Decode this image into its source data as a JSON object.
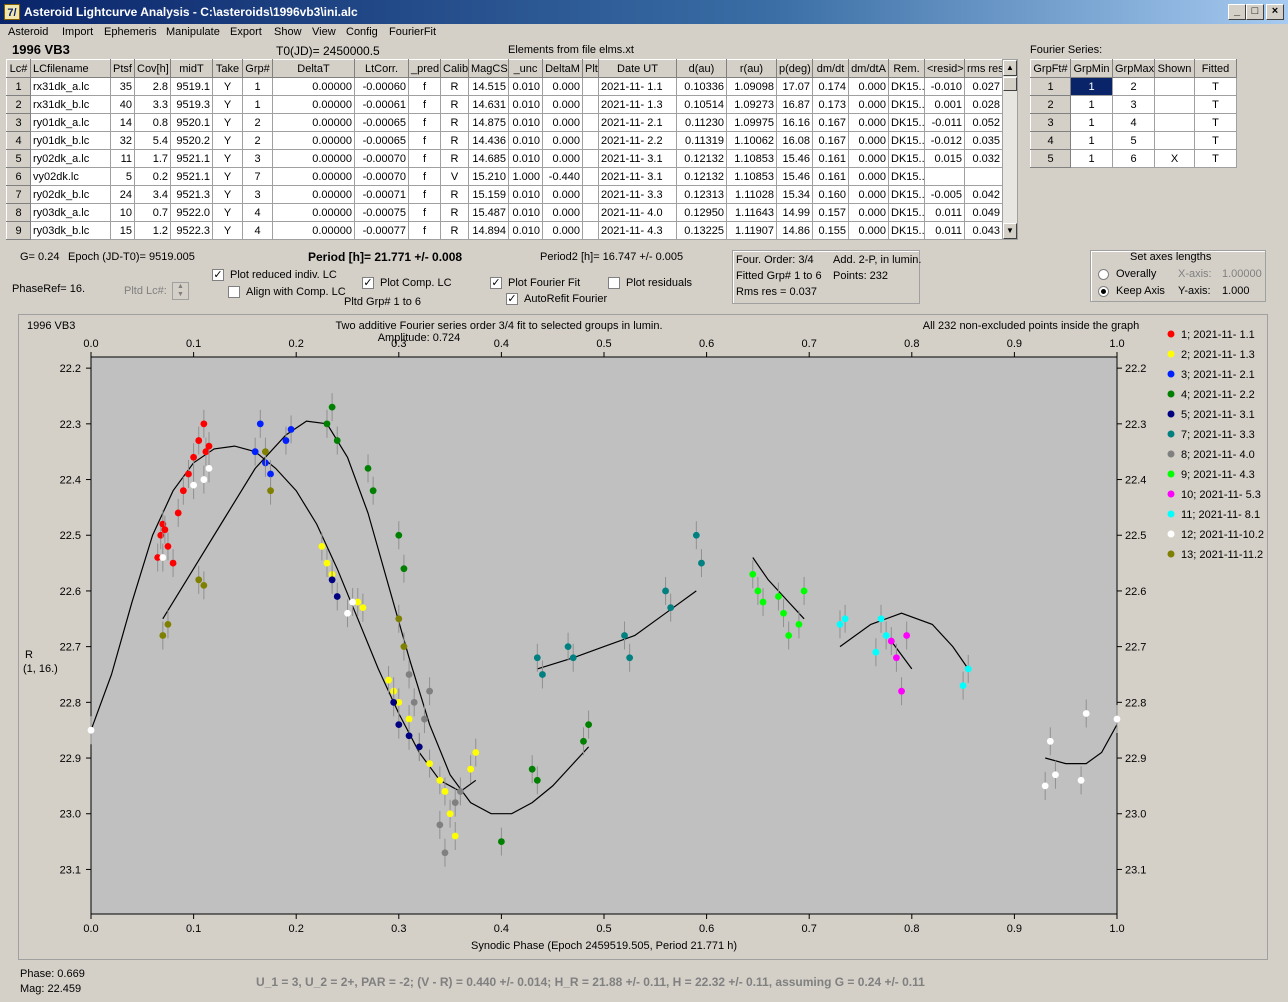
{
  "window": {
    "title": "Asteroid Lightcurve Analysis - C:\\asteroids\\1996vb3\\ini.alc",
    "icon_glyph": "7/"
  },
  "menu": [
    "Asteroid",
    "Import",
    "Ephemeris",
    "Manipulate",
    "Export",
    "Show",
    "View",
    "Config",
    "FourierFit"
  ],
  "header": {
    "object": "1996 VB3",
    "t0": "T0(JD)= 2450000.5",
    "elements": "Elements from file elms.xt",
    "fourier_series_label": "Fourier Series:"
  },
  "lc_table": {
    "columns": [
      "Lc#",
      "LCfilename",
      "Ptsf",
      "Cov[h]",
      "midT",
      "Take",
      "Grp#",
      "DeltaT",
      "LtCorr.",
      "_pred.",
      "Calib.",
      "MagCS",
      "_unc",
      "DeltaM",
      "Plt",
      "Date UT",
      "d(au)",
      "r(au)",
      "p(deg)",
      "dm/dt",
      "dm/dtA",
      "Rem.",
      "<resid>",
      "rms res"
    ],
    "rows": [
      [
        "1",
        "rx31dk_a.lc",
        "35",
        "2.8",
        "9519.1",
        "Y",
        "1",
        "0.00000",
        "-0.00060",
        "f",
        "R",
        "14.515",
        "0.010",
        "0.000",
        "",
        "2021-11- 1.1",
        "0.10336",
        "1.09098",
        "17.07",
        "0.174",
        "0.000",
        "DK15...",
        "-0.010",
        "0.027"
      ],
      [
        "2",
        "rx31dk_b.lc",
        "40",
        "3.3",
        "9519.3",
        "Y",
        "1",
        "0.00000",
        "-0.00061",
        "f",
        "R",
        "14.631",
        "0.010",
        "0.000",
        "",
        "2021-11- 1.3",
        "0.10514",
        "1.09273",
        "16.87",
        "0.173",
        "0.000",
        "DK15...",
        "0.001",
        "0.028"
      ],
      [
        "3",
        "ry01dk_a.lc",
        "14",
        "0.8",
        "9520.1",
        "Y",
        "2",
        "0.00000",
        "-0.00065",
        "f",
        "R",
        "14.875",
        "0.010",
        "0.000",
        "",
        "2021-11- 2.1",
        "0.11230",
        "1.09975",
        "16.16",
        "0.167",
        "0.000",
        "DK15...",
        "-0.011",
        "0.052"
      ],
      [
        "4",
        "ry01dk_b.lc",
        "32",
        "5.4",
        "9520.2",
        "Y",
        "2",
        "0.00000",
        "-0.00065",
        "f",
        "R",
        "14.436",
        "0.010",
        "0.000",
        "",
        "2021-11- 2.2",
        "0.11319",
        "1.10062",
        "16.08",
        "0.167",
        "0.000",
        "DK15...",
        "-0.012",
        "0.035"
      ],
      [
        "5",
        "ry02dk_a.lc",
        "11",
        "1.7",
        "9521.1",
        "Y",
        "3",
        "0.00000",
        "-0.00070",
        "f",
        "R",
        "14.685",
        "0.010",
        "0.000",
        "",
        "2021-11- 3.1",
        "0.12132",
        "1.10853",
        "15.46",
        "0.161",
        "0.000",
        "DK15...",
        "0.015",
        "0.032"
      ],
      [
        "6",
        "vy02dk.lc",
        "5",
        "0.2",
        "9521.1",
        "Y",
        "7",
        "0.00000",
        "-0.00070",
        "f",
        "V",
        "15.210",
        "1.000",
        "-0.440",
        "",
        "2021-11- 3.1",
        "0.12132",
        "1.10853",
        "15.46",
        "0.161",
        "0.000",
        "DK15...",
        "",
        ""
      ],
      [
        "7",
        "ry02dk_b.lc",
        "24",
        "3.4",
        "9521.3",
        "Y",
        "3",
        "0.00000",
        "-0.00071",
        "f",
        "R",
        "15.159",
        "0.010",
        "0.000",
        "",
        "2021-11- 3.3",
        "0.12313",
        "1.11028",
        "15.34",
        "0.160",
        "0.000",
        "DK15...",
        "-0.005",
        "0.042"
      ],
      [
        "8",
        "ry03dk_a.lc",
        "10",
        "0.7",
        "9522.0",
        "Y",
        "4",
        "0.00000",
        "-0.00075",
        "f",
        "R",
        "15.487",
        "0.010",
        "0.000",
        "",
        "2021-11- 4.0",
        "0.12950",
        "1.11643",
        "14.99",
        "0.157",
        "0.000",
        "DK15...",
        "0.011",
        "0.049"
      ],
      [
        "9",
        "ry03dk_b.lc",
        "15",
        "1.2",
        "9522.3",
        "Y",
        "4",
        "0.00000",
        "-0.00077",
        "f",
        "R",
        "14.894",
        "0.010",
        "0.000",
        "",
        "2021-11- 4.3",
        "0.13225",
        "1.11907",
        "14.86",
        "0.155",
        "0.000",
        "DK15...",
        "0.011",
        "0.043"
      ]
    ]
  },
  "fourier_table": {
    "columns": [
      "GrpFt#",
      "GrpMin",
      "GrpMax",
      "Shown",
      "Fitted"
    ],
    "rows": [
      [
        "1",
        "1",
        "2",
        "",
        "T"
      ],
      [
        "2",
        "1",
        "3",
        "",
        "T"
      ],
      [
        "3",
        "1",
        "4",
        "",
        "T"
      ],
      [
        "4",
        "1",
        "5",
        "",
        "T"
      ],
      [
        "5",
        "1",
        "6",
        "X",
        "T"
      ]
    ]
  },
  "controls": {
    "g_value": "G= 0.24",
    "epoch": "Epoch (JD-T0)= 9519.005",
    "period": "Period [h]= 21.771 +/- 0.008",
    "period2": "Period2 [h]= 16.747 +/- 0.005",
    "phase_ref": "PhaseRef= 16.",
    "pltd_lc": "Pltd Lc#:",
    "plot_reduced": "Plot reduced indiv. LC",
    "align_comp": "Align with Comp. LC",
    "plot_comp": "Plot Comp. LC",
    "pltd_grp": "Pltd Grp#  1   to   6",
    "plot_fourier": "Plot Fourier Fit",
    "autorefit": "AutoRefit Fourier",
    "plot_residuals": "Plot residuals",
    "fourier_info": [
      "Four. Order:  3/4",
      "Add. 2-P, in lumin.",
      "Fitted Grp# 1 to 6",
      "Points: 232",
      "Rms res     = 0.037"
    ],
    "axes_title": "Set axes lengths",
    "overally": "Overally",
    "keep_axis": "Keep Axis",
    "x_axis_label": "X-axis:",
    "x_axis_value": "1.00000",
    "y_axis_label": "Y-axis:",
    "y_axis_value": "1.000"
  },
  "status": {
    "phase": "Phase:  0.669",
    "mag": "Mag:    22.459",
    "summary": "U_1 = 3, U_2 = 2+, PAR = -2; (V - R) = 0.440 +/- 0.014; H_R = 21.88 +/- 0.11, H = 22.32 +/- 0.11, assuming G = 0.24 +/- 0.11"
  },
  "chart_data": {
    "type": "scatter",
    "corner_label": "1996 VB3",
    "title": "Two additive Fourier series order 3/4 fit to selected groups in lumin.",
    "subtitle": "Amplitude: 0.724",
    "note": "All 232 non-excluded points inside the graph",
    "xlabel": "Synodic Phase (Epoch 2459519.505, Period 21.771 h)",
    "ylabel": "R",
    "ylabel2": "(1, 16.)",
    "xlim": [
      0,
      1
    ],
    "ylim": [
      22.18,
      23.18
    ],
    "yreversed": true,
    "xticks": [
      "0.0",
      "0.1",
      "0.2",
      "0.3",
      "0.4",
      "0.5",
      "0.6",
      "0.7",
      "0.8",
      "0.9",
      "1.0"
    ],
    "yticks": [
      "22.2",
      "22.3",
      "22.4",
      "22.5",
      "22.6",
      "22.7",
      "22.8",
      "22.9",
      "23.0",
      "23.1"
    ],
    "grid": false,
    "legend_position": "right",
    "series": [
      {
        "name": "1; 2021-11- 1.1",
        "color": "#ff0000",
        "points": [
          [
            0.065,
            22.54
          ],
          [
            0.068,
            22.5
          ],
          [
            0.07,
            22.48
          ],
          [
            0.072,
            22.49
          ],
          [
            0.075,
            22.52
          ],
          [
            0.08,
            22.55
          ],
          [
            0.085,
            22.46
          ],
          [
            0.09,
            22.42
          ],
          [
            0.095,
            22.39
          ],
          [
            0.1,
            22.36
          ],
          [
            0.105,
            22.33
          ],
          [
            0.11,
            22.3
          ],
          [
            0.112,
            22.35
          ],
          [
            0.115,
            22.34
          ]
        ]
      },
      {
        "name": "2; 2021-11- 1.3",
        "color": "#ffff00",
        "points": [
          [
            0.225,
            22.52
          ],
          [
            0.23,
            22.55
          ],
          [
            0.235,
            22.57
          ],
          [
            0.26,
            22.62
          ],
          [
            0.265,
            22.63
          ],
          [
            0.29,
            22.76
          ],
          [
            0.295,
            22.78
          ],
          [
            0.3,
            22.8
          ],
          [
            0.31,
            22.83
          ],
          [
            0.32,
            22.88
          ],
          [
            0.33,
            22.91
          ],
          [
            0.34,
            22.94
          ],
          [
            0.345,
            22.96
          ],
          [
            0.35,
            23.0
          ],
          [
            0.355,
            23.04
          ],
          [
            0.37,
            22.92
          ],
          [
            0.375,
            22.89
          ]
        ]
      },
      {
        "name": "3; 2021-11- 2.1",
        "color": "#0020ff",
        "points": [
          [
            0.16,
            22.35
          ],
          [
            0.165,
            22.3
          ],
          [
            0.17,
            22.37
          ],
          [
            0.175,
            22.39
          ],
          [
            0.19,
            22.33
          ],
          [
            0.195,
            22.31
          ]
        ]
      },
      {
        "name": "4; 2021-11- 2.2",
        "color": "#008000",
        "points": [
          [
            0.23,
            22.3
          ],
          [
            0.235,
            22.27
          ],
          [
            0.24,
            22.33
          ],
          [
            0.27,
            22.38
          ],
          [
            0.275,
            22.42
          ],
          [
            0.3,
            22.5
          ],
          [
            0.305,
            22.56
          ],
          [
            0.4,
            23.05
          ],
          [
            0.43,
            22.92
          ],
          [
            0.435,
            22.94
          ],
          [
            0.48,
            22.87
          ],
          [
            0.485,
            22.84
          ]
        ]
      },
      {
        "name": "5; 2021-11- 3.1",
        "color": "#000080",
        "points": [
          [
            0.235,
            22.58
          ],
          [
            0.24,
            22.61
          ],
          [
            0.295,
            22.8
          ],
          [
            0.3,
            22.84
          ],
          [
            0.31,
            22.86
          ],
          [
            0.32,
            22.88
          ]
        ]
      },
      {
        "name": "7; 2021-11- 3.3",
        "color": "#008080",
        "points": [
          [
            0.435,
            22.72
          ],
          [
            0.44,
            22.75
          ],
          [
            0.465,
            22.7
          ],
          [
            0.47,
            22.72
          ],
          [
            0.52,
            22.68
          ],
          [
            0.525,
            22.72
          ],
          [
            0.56,
            22.6
          ],
          [
            0.565,
            22.63
          ],
          [
            0.59,
            22.5
          ],
          [
            0.595,
            22.55
          ]
        ]
      },
      {
        "name": "8; 2021-11- 4.0",
        "color": "#808080",
        "points": [
          [
            0.31,
            22.75
          ],
          [
            0.315,
            22.8
          ],
          [
            0.325,
            22.83
          ],
          [
            0.33,
            22.78
          ],
          [
            0.34,
            23.02
          ],
          [
            0.345,
            23.07
          ],
          [
            0.355,
            22.98
          ],
          [
            0.36,
            22.96
          ]
        ]
      },
      {
        "name": "9; 2021-11- 4.3",
        "color": "#00ff00",
        "points": [
          [
            0.645,
            22.57
          ],
          [
            0.65,
            22.6
          ],
          [
            0.655,
            22.62
          ],
          [
            0.67,
            22.61
          ],
          [
            0.675,
            22.64
          ],
          [
            0.68,
            22.68
          ],
          [
            0.69,
            22.66
          ],
          [
            0.695,
            22.6
          ]
        ]
      },
      {
        "name": "10; 2021-11- 5.3",
        "color": "#ff00ff",
        "points": [
          [
            0.78,
            22.69
          ],
          [
            0.785,
            22.72
          ],
          [
            0.79,
            22.78
          ],
          [
            0.795,
            22.68
          ]
        ]
      },
      {
        "name": "11; 2021-11- 8.1",
        "color": "#00ffff",
        "points": [
          [
            0.73,
            22.66
          ],
          [
            0.735,
            22.65
          ],
          [
            0.765,
            22.71
          ],
          [
            0.77,
            22.65
          ],
          [
            0.775,
            22.68
          ],
          [
            0.85,
            22.77
          ],
          [
            0.855,
            22.74
          ]
        ]
      },
      {
        "name": "12; 2021-11-10.2",
        "color": "#ffffff",
        "points": [
          [
            0.0,
            22.85
          ],
          [
            0.07,
            22.54
          ],
          [
            0.1,
            22.41
          ],
          [
            0.11,
            22.4
          ],
          [
            0.115,
            22.38
          ],
          [
            0.25,
            22.64
          ],
          [
            0.255,
            22.62
          ],
          [
            0.93,
            22.95
          ],
          [
            0.935,
            22.87
          ],
          [
            0.94,
            22.93
          ],
          [
            0.965,
            22.94
          ],
          [
            0.97,
            22.82
          ],
          [
            1.0,
            22.83
          ]
        ]
      },
      {
        "name": "13; 2021-11-11.2",
        "color": "#808000",
        "points": [
          [
            0.07,
            22.68
          ],
          [
            0.075,
            22.66
          ],
          [
            0.105,
            22.58
          ],
          [
            0.11,
            22.59
          ],
          [
            0.17,
            22.35
          ],
          [
            0.175,
            22.42
          ],
          [
            0.3,
            22.65
          ],
          [
            0.305,
            22.7
          ]
        ]
      }
    ],
    "fit_curves": [
      {
        "points": [
          [
            0.0,
            22.85
          ],
          [
            0.02,
            22.75
          ],
          [
            0.04,
            22.62
          ],
          [
            0.06,
            22.5
          ],
          [
            0.08,
            22.42
          ],
          [
            0.1,
            22.37
          ],
          [
            0.12,
            22.345
          ],
          [
            0.14,
            22.34
          ],
          [
            0.16,
            22.35
          ],
          [
            0.18,
            22.38
          ],
          [
            0.2,
            22.42
          ],
          [
            0.22,
            22.48
          ],
          [
            0.24,
            22.56
          ],
          [
            0.26,
            22.65
          ],
          [
            0.28,
            22.74
          ],
          [
            0.3,
            22.82
          ],
          [
            0.32,
            22.89
          ],
          [
            0.34,
            22.94
          ],
          [
            0.36,
            22.96
          ],
          [
            0.375,
            22.94
          ]
        ]
      },
      {
        "points": [
          [
            0.07,
            22.65
          ],
          [
            0.1,
            22.56
          ],
          [
            0.13,
            22.47
          ],
          [
            0.16,
            22.38
          ],
          [
            0.19,
            22.32
          ],
          [
            0.21,
            22.295
          ],
          [
            0.23,
            22.3
          ],
          [
            0.25,
            22.36
          ],
          [
            0.27,
            22.46
          ],
          [
            0.29,
            22.59
          ],
          [
            0.31,
            22.72
          ],
          [
            0.33,
            22.84
          ],
          [
            0.35,
            22.93
          ],
          [
            0.37,
            22.98
          ],
          [
            0.39,
            23.0
          ],
          [
            0.41,
            23.0
          ],
          [
            0.43,
            22.98
          ],
          [
            0.45,
            22.95
          ],
          [
            0.47,
            22.91
          ],
          [
            0.485,
            22.88
          ]
        ]
      },
      {
        "points": [
          [
            0.435,
            22.74
          ],
          [
            0.47,
            22.72
          ],
          [
            0.5,
            22.7
          ],
          [
            0.53,
            22.68
          ],
          [
            0.56,
            22.64
          ],
          [
            0.59,
            22.6
          ]
        ]
      },
      {
        "points": [
          [
            0.645,
            22.54
          ],
          [
            0.66,
            22.58
          ],
          [
            0.68,
            22.62
          ],
          [
            0.695,
            22.65
          ]
        ]
      },
      {
        "points": [
          [
            0.73,
            22.7
          ],
          [
            0.76,
            22.66
          ],
          [
            0.79,
            22.64
          ],
          [
            0.82,
            22.66
          ],
          [
            0.84,
            22.7
          ],
          [
            0.855,
            22.74
          ]
        ]
      },
      {
        "points": [
          [
            0.78,
            22.69
          ],
          [
            0.8,
            22.74
          ]
        ]
      },
      {
        "points": [
          [
            0.93,
            22.9
          ],
          [
            0.95,
            22.91
          ],
          [
            0.97,
            22.91
          ],
          [
            0.985,
            22.89
          ],
          [
            1.0,
            22.84
          ]
        ]
      }
    ]
  }
}
